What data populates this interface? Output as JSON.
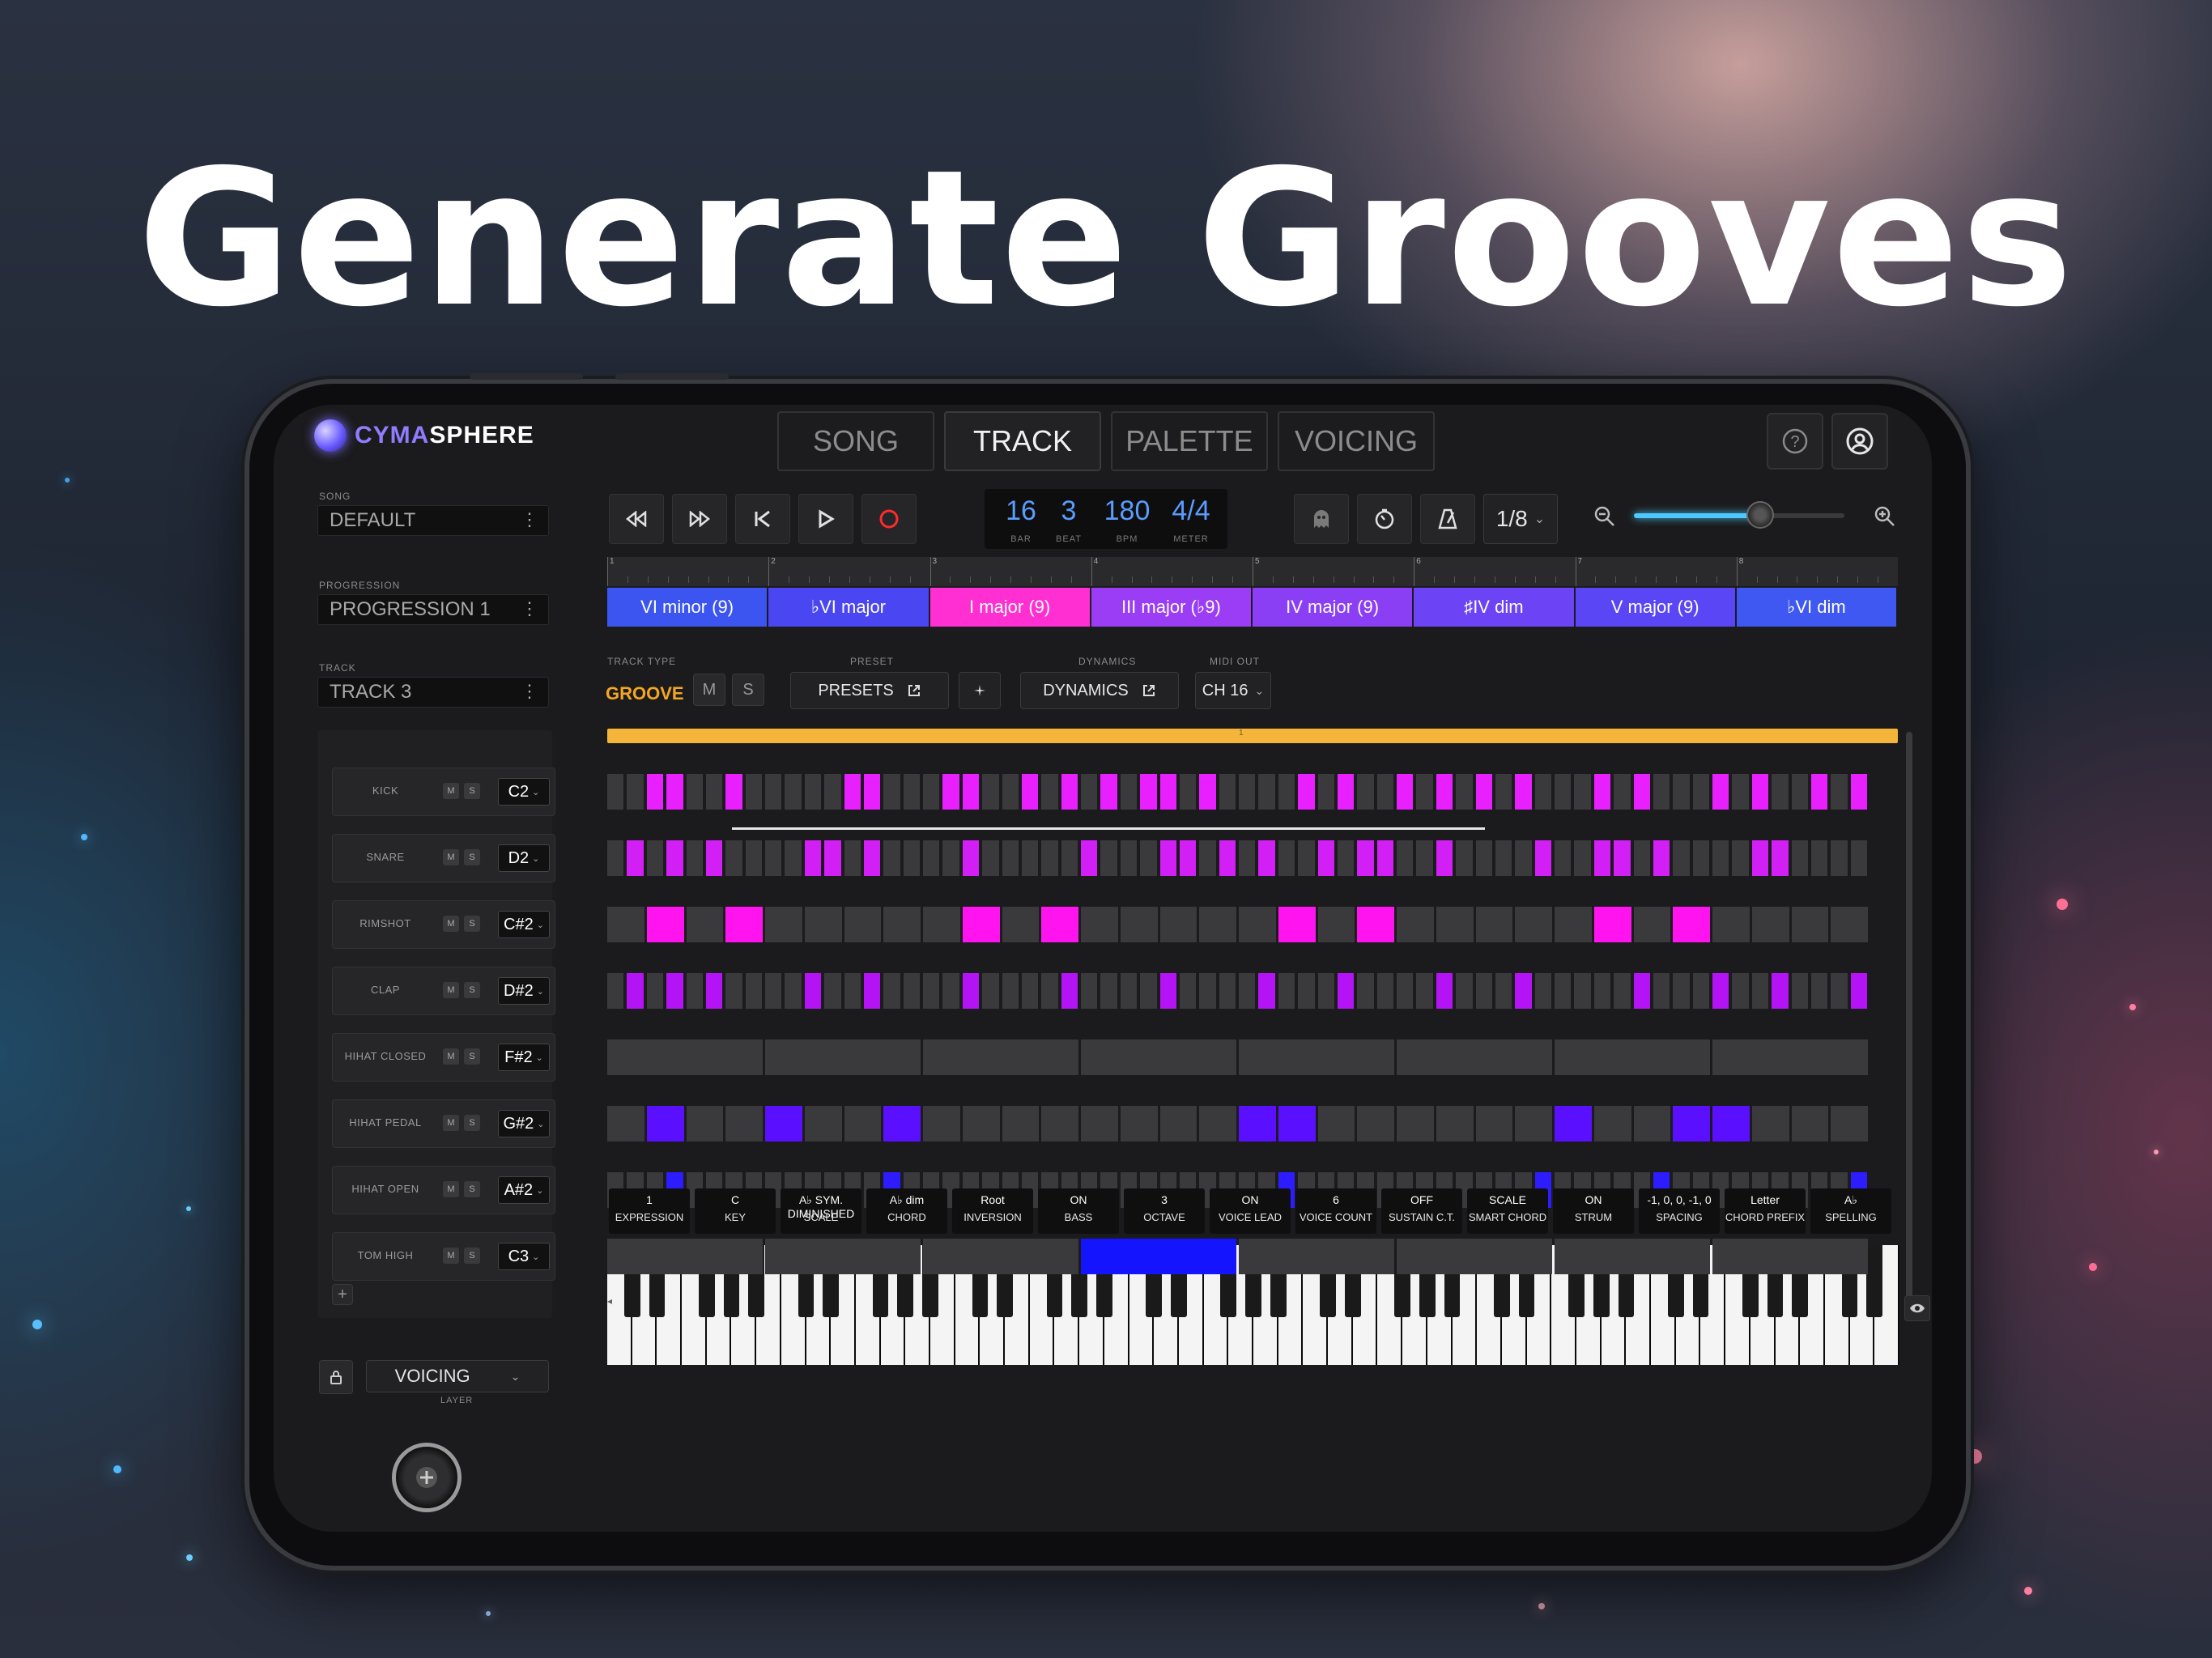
{
  "headline": "Generate Grooves",
  "app": {
    "logo_prefix": "CYMA",
    "logo_suffix": "SPHERE"
  },
  "tabs": [
    {
      "label": "SONG",
      "active": false
    },
    {
      "label": "TRACK",
      "active": true
    },
    {
      "label": "PALETTE",
      "active": false
    },
    {
      "label": "VOICING",
      "active": false
    }
  ],
  "header_icons": [
    "help-icon",
    "account-icon"
  ],
  "left_panel": {
    "song_label": "SONG",
    "song_value": "DEFAULT",
    "progression_label": "PROGRESSION",
    "progression_value": "PROGRESSION 1",
    "track_label": "TRACK",
    "track_value": "TRACK 3",
    "menu_glyph": "⋮"
  },
  "transport": {
    "icons": [
      "rewind-icon",
      "fast-forward-icon",
      "skip-to-start-icon",
      "play-icon",
      "record-icon"
    ],
    "bar": "16",
    "bar_label": "BAR",
    "beat": "3",
    "beat_label": "BEAT",
    "bpm": "180",
    "bpm_label": "BPM",
    "meter": "4/4",
    "meter_label": "METER",
    "quantize": "1/8",
    "zoom": 0.6
  },
  "timeline_bars": [
    "1",
    "2",
    "3",
    "4",
    "5",
    "6",
    "7",
    "8"
  ],
  "chords": [
    {
      "label": "VI minor (9)",
      "color": "#3c55f0"
    },
    {
      "label": "♭VI major",
      "color": "#4a46f2"
    },
    {
      "label": "I major (9)",
      "color": "#ff2fd2"
    },
    {
      "label": "III major (♭9)",
      "color": "#9a3df5"
    },
    {
      "label": "IV major (9)",
      "color": "#8a3ff5"
    },
    {
      "label": "♯IV dim",
      "color": "#6c43f5"
    },
    {
      "label": "V major (9)",
      "color": "#5a46f5"
    },
    {
      "label": "♭VI dim",
      "color": "#3f58f2"
    }
  ],
  "track_controls": {
    "track_type_label": "TRACK TYPE",
    "track_type_value": "GROOVE",
    "mute": "M",
    "solo": "S",
    "preset_label": "PRESET",
    "preset_value": "PRESETS",
    "dynamics_label": "DYNAMICS",
    "dynamics_value": "DYNAMICS",
    "midi_out_label": "MIDI OUT",
    "midi_out_value": "CH 16"
  },
  "playhead_marker": "1",
  "instruments": [
    {
      "name": "KICK",
      "note": "C2"
    },
    {
      "name": "SNARE",
      "note": "D2"
    },
    {
      "name": "RIMSHOT",
      "note": "C#2"
    },
    {
      "name": "CLAP",
      "note": "D#2"
    },
    {
      "name": "HIHAT CLOSED",
      "note": "F#2"
    },
    {
      "name": "HIHAT PEDAL",
      "note": "G#2"
    },
    {
      "name": "HIHAT OPEN",
      "note": "A#2"
    },
    {
      "name": "TOM HIGH",
      "note": "C3"
    }
  ],
  "add_track_glyph": "+",
  "lanes": [
    {
      "steps": 64,
      "color": "#e81fff",
      "active": [
        2,
        3,
        6,
        12,
        13,
        17,
        18,
        21,
        23,
        25,
        27,
        28,
        30,
        35,
        37,
        40,
        42,
        44,
        46,
        50,
        52,
        56,
        58,
        61,
        63
      ]
    },
    {
      "steps": 64,
      "color": "#d21ff5",
      "active": [
        1,
        3,
        5,
        10,
        11,
        13,
        18,
        24,
        28,
        29,
        31,
        33,
        36,
        38,
        39,
        42,
        47,
        50,
        51,
        53,
        58,
        59
      ]
    },
    {
      "steps": 32,
      "color": "#ff14f0",
      "active": [
        1,
        3,
        9,
        11,
        17,
        19,
        25,
        27
      ]
    },
    {
      "steps": 64,
      "color": "#b414f5",
      "active": [
        1,
        3,
        5,
        10,
        13,
        18,
        23,
        28,
        33,
        37,
        42,
        46,
        52,
        56,
        59,
        63
      ]
    },
    {
      "steps": 8,
      "color": "#4b1bff",
      "active": []
    },
    {
      "steps": 32,
      "color": "#5a10ff",
      "active": [
        1,
        4,
        7,
        16,
        17,
        24,
        27,
        28
      ]
    },
    {
      "steps": 64,
      "color": "#2d1cff",
      "active": [
        3,
        14,
        34,
        47,
        53,
        63
      ]
    },
    {
      "steps": 8,
      "color": "#1414ff",
      "active": [
        3
      ]
    }
  ],
  "layer": {
    "label": "LAYER",
    "value": "VOICING"
  },
  "params": [
    {
      "value": "1",
      "key": "EXPRESSION"
    },
    {
      "value": "C",
      "key": "KEY"
    },
    {
      "value": "A♭ SYM. DIMINISHED",
      "key": "SCALE"
    },
    {
      "value": "A♭ dim",
      "key": "CHORD"
    },
    {
      "value": "Root",
      "key": "INVERSION"
    },
    {
      "value": "ON",
      "key": "BASS"
    },
    {
      "value": "3",
      "key": "OCTAVE"
    },
    {
      "value": "ON",
      "key": "VOICE LEAD"
    },
    {
      "value": "6",
      "key": "VOICE COUNT"
    },
    {
      "value": "OFF",
      "key": "SUSTAIN C.T."
    },
    {
      "value": "SCALE",
      "key": "SMART CHORD"
    },
    {
      "value": "ON",
      "key": "STRUM"
    },
    {
      "value": "-1, 0, 0, -1, 0",
      "key": "SPACING"
    },
    {
      "value": "Letter",
      "key": "CHORD PREFIX"
    },
    {
      "value": "A♭",
      "key": "SPELLING"
    }
  ],
  "keyboard": {
    "white_keys": 52
  }
}
